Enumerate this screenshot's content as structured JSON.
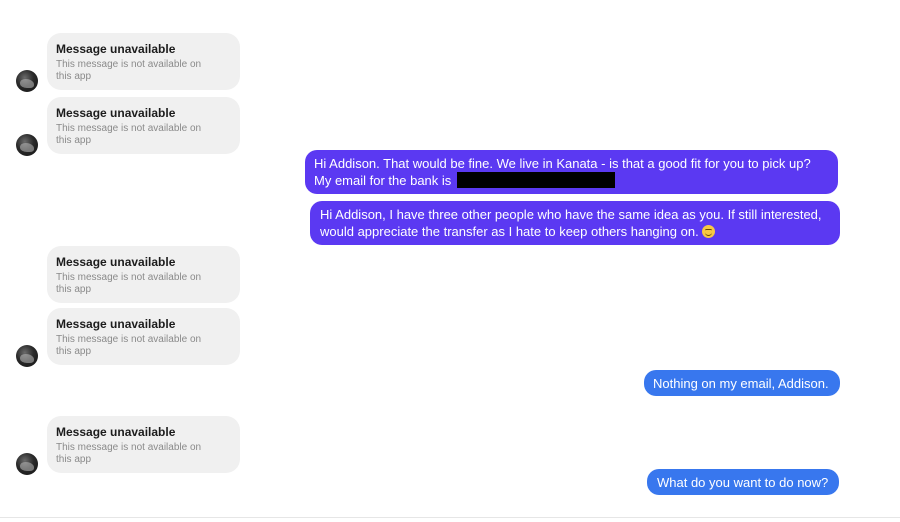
{
  "received": [
    {
      "title": "Message unavailable",
      "subtitle": "This message is not available on this app"
    },
    {
      "title": "Message unavailable",
      "subtitle": "This message is not available on this app"
    },
    {
      "title": "Message unavailable",
      "subtitle": "This message is not available on this app"
    },
    {
      "title": "Message unavailable",
      "subtitle": "This message is not available on this app"
    },
    {
      "title": "Message unavailable",
      "subtitle": "This message is not available on this app"
    }
  ],
  "sent": [
    {
      "line1": "Hi Addison.  That would be fine.  We live in Kanata - is that a good fit for you to pick up?",
      "line2": "My email for the bank is"
    },
    {
      "line1": "Hi Addison, I have three other people who have the same idea as you.  If still interested,",
      "line2": "would appreciate the transfer as I hate to keep others hanging on."
    },
    {
      "text": "Nothing on my email, Addison."
    },
    {
      "text": "What do you want to do now?"
    }
  ],
  "colors": {
    "sent_purple": "#5b39f2",
    "sent_blue": "#3877ee",
    "received_bg": "#f0f0f0"
  },
  "icons": {
    "avatar": "contact-avatar",
    "emoji": "smiling-face-emoji"
  }
}
